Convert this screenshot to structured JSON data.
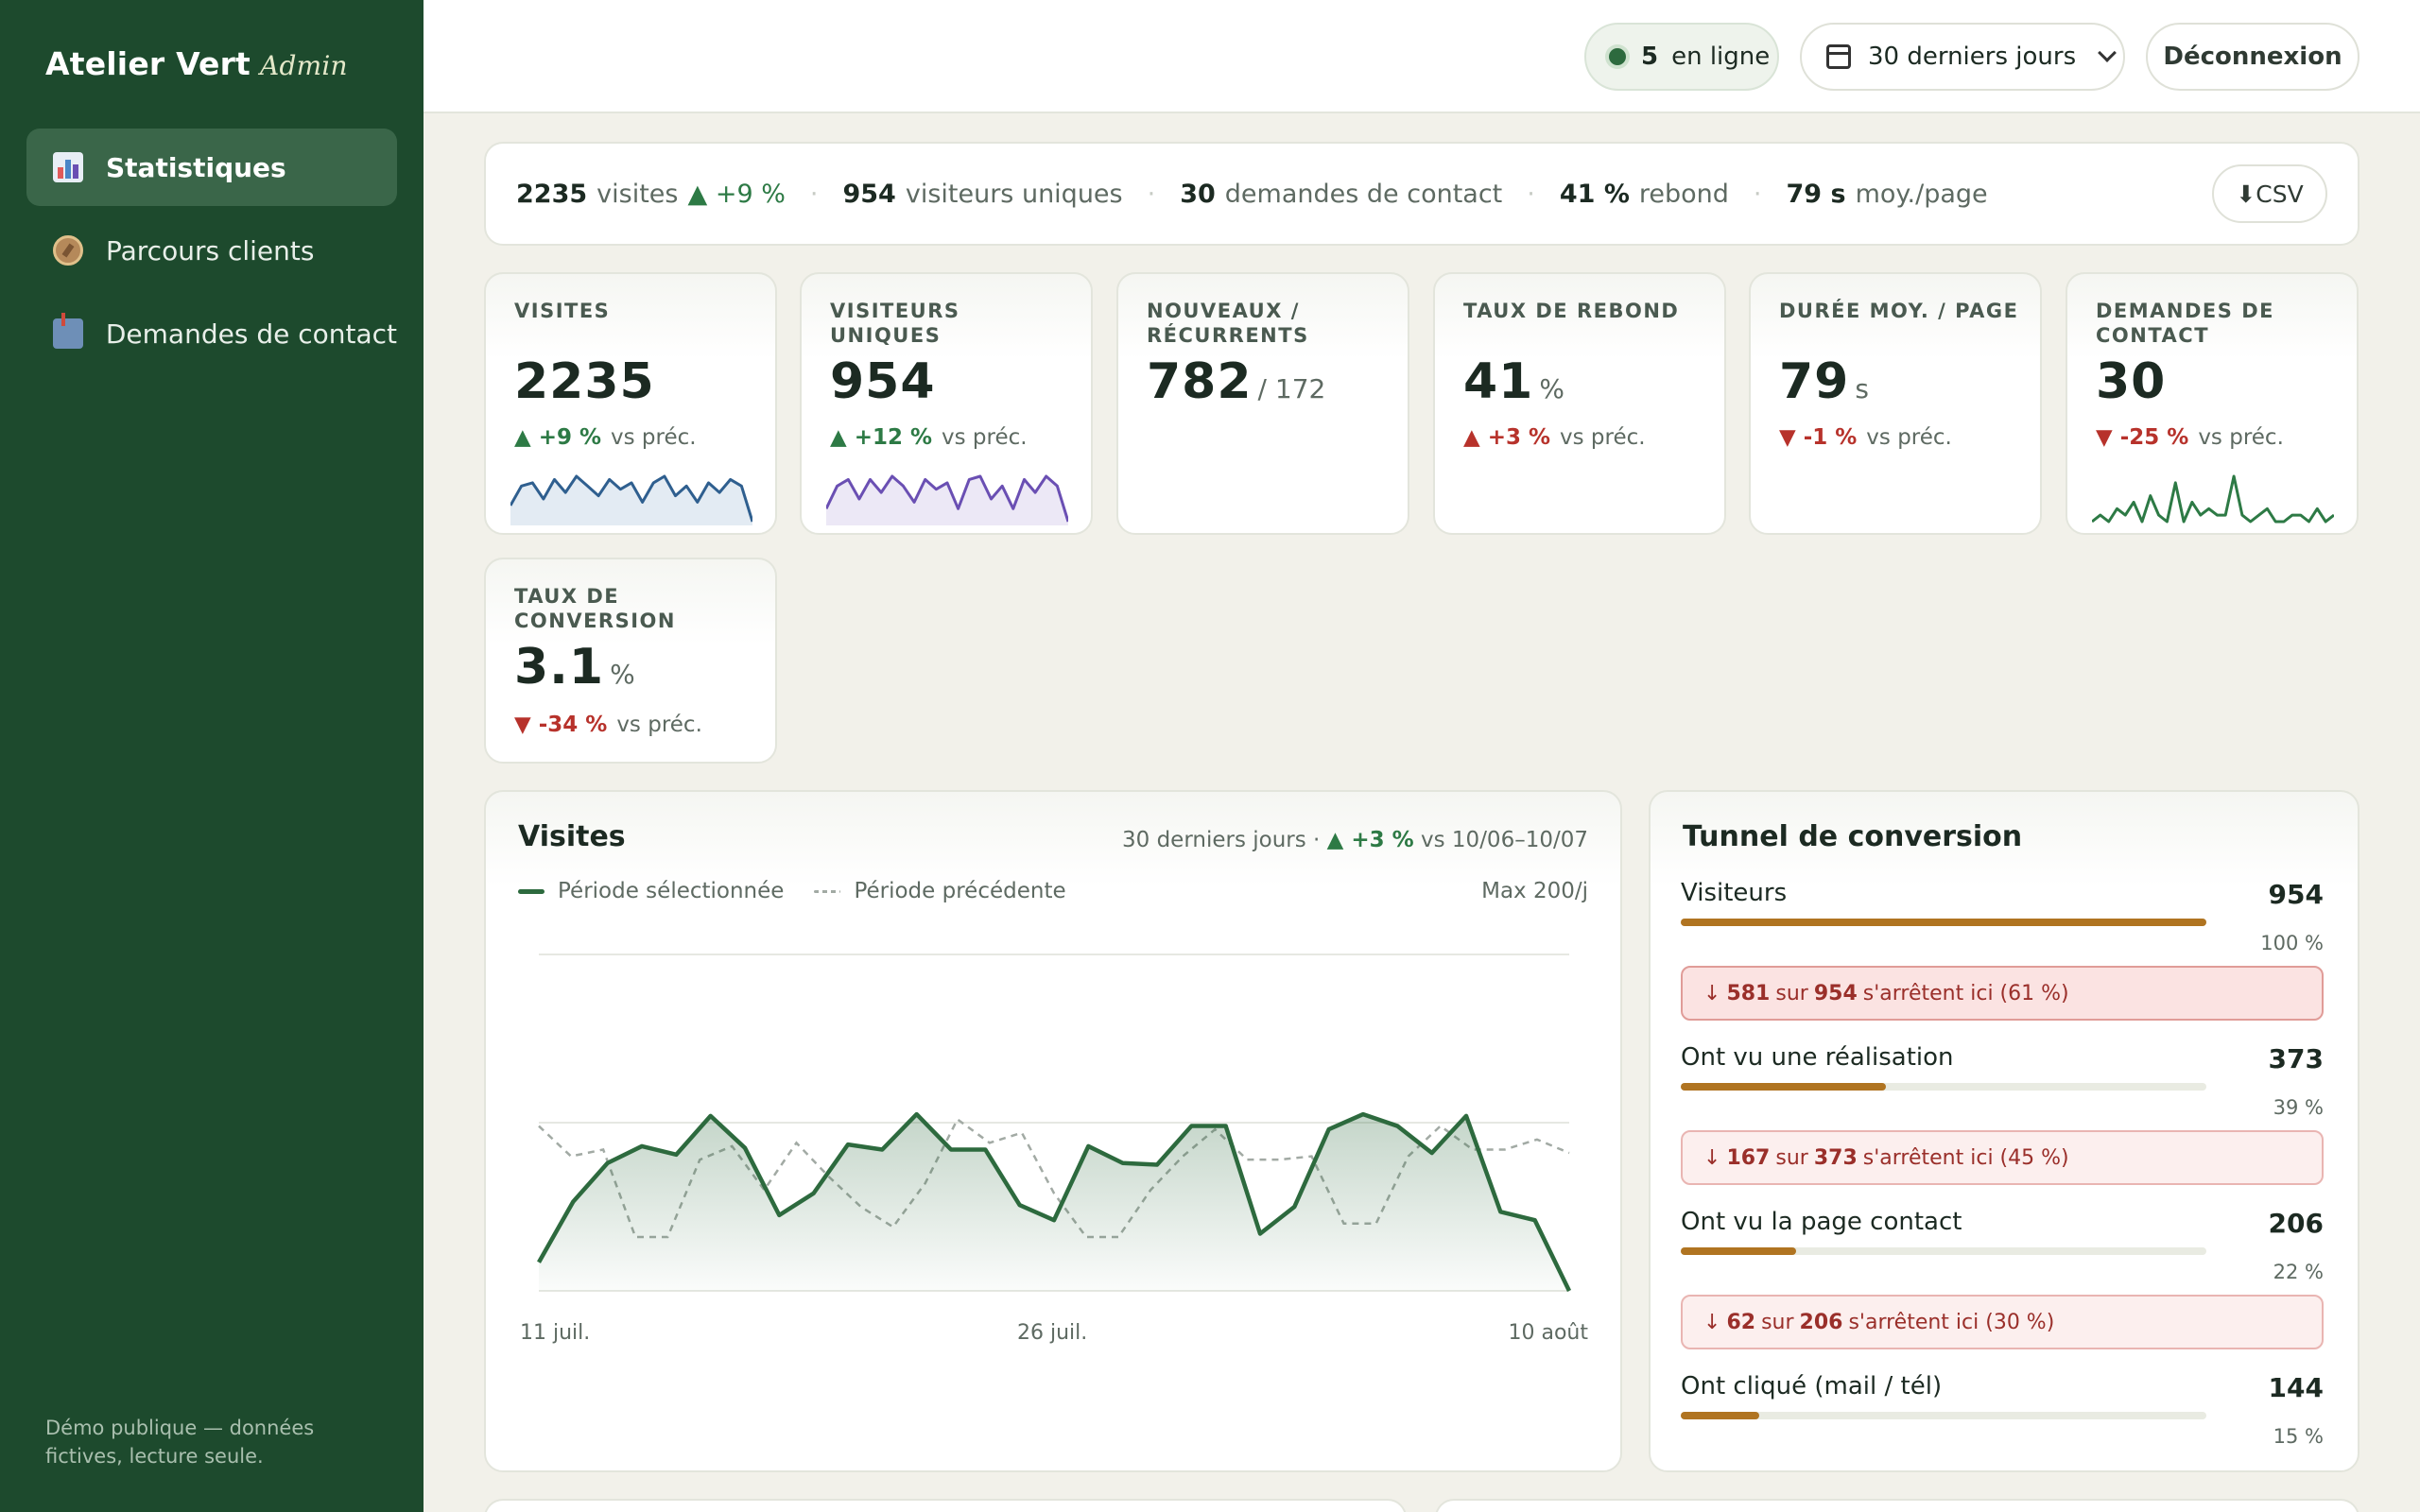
{
  "app": {
    "brand": "Atelier Vert",
    "brand_sub": "Admin"
  },
  "sidebar": {
    "items": [
      {
        "label": "Statistiques",
        "icon": "bar-chart-icon",
        "active": true
      },
      {
        "label": "Parcours clients",
        "icon": "compass-icon",
        "active": false
      },
      {
        "label": "Demandes de contact",
        "icon": "mailbox-icon",
        "active": false
      }
    ],
    "footer": "Démo publique — données fictives, lecture seule."
  },
  "topbar": {
    "online_count": "5",
    "online_label": "en ligne",
    "period": "30 derniers jours",
    "logout": "Déconnexion"
  },
  "summary": {
    "visits": "2235",
    "visits_label": "visites",
    "visits_delta": "▲ +9 %",
    "uniques": "954",
    "uniques_label": "visiteurs uniques",
    "contacts": "30",
    "contacts_label": "demandes de contact",
    "bounce": "41 %",
    "bounce_label": "rebond",
    "avg": "79 s",
    "avg_label": "moy./page",
    "csv": "⬇CSV"
  },
  "kpis": [
    {
      "label": "Visites",
      "value": "2235",
      "unit": "",
      "delta": "▲ +9 %",
      "delta_dir": "pos",
      "vs": "vs préc."
    },
    {
      "label": "Visiteurs uniques",
      "value": "954",
      "unit": "",
      "delta": "▲ +12 %",
      "delta_dir": "pos",
      "vs": "vs préc."
    },
    {
      "label": "Nouveaux / récurrents",
      "value": "782",
      "unit": "/ 172",
      "delta": "",
      "delta_dir": "",
      "vs": ""
    },
    {
      "label": "Taux de rebond",
      "value": "41",
      "unit": "%",
      "delta": "▲ +3 %",
      "delta_dir": "neg",
      "vs": "vs préc."
    },
    {
      "label": "Durée moy. / page",
      "value": "79",
      "unit": "s",
      "delta": "▼ -1 %",
      "delta_dir": "neg",
      "vs": "vs préc."
    },
    {
      "label": "Demandes de contact",
      "value": "30",
      "unit": "",
      "delta": "▼ -25 %",
      "delta_dir": "neg",
      "vs": "vs préc."
    },
    {
      "label": "Taux de conversion",
      "value": "3.1",
      "unit": "%",
      "delta": "▼ -34 %",
      "delta_dir": "neg",
      "vs": "vs préc."
    }
  ],
  "sparklines": {
    "visits": {
      "color": "#2f5f8f",
      "fill": "#e3ebf3",
      "values": [
        58,
        70,
        72,
        62,
        74,
        66,
        76,
        70,
        64,
        74,
        68,
        72,
        60,
        72,
        76,
        64,
        70,
        60,
        72,
        66,
        74,
        70,
        48
      ]
    },
    "uniques": {
      "color": "#6a4fb3",
      "fill": "#ece8f6",
      "values": [
        52,
        66,
        70,
        58,
        70,
        62,
        72,
        66,
        56,
        70,
        64,
        68,
        52,
        70,
        72,
        58,
        66,
        52,
        70,
        62,
        72,
        66,
        44
      ]
    },
    "contacts": {
      "color": "#2d7a45",
      "fill": "none",
      "values": [
        2,
        3,
        2,
        4,
        3,
        5,
        2,
        6,
        3,
        2,
        8,
        2,
        5,
        3,
        4,
        3,
        3,
        9,
        3,
        2,
        3,
        4,
        2,
        2,
        3,
        3,
        2,
        4,
        2,
        3
      ]
    }
  },
  "visits_chart": {
    "title": "Visites",
    "meta_period": "30 derniers jours ·",
    "meta_delta": "▲ +3 %",
    "meta_compare": "vs 10/06–10/07",
    "max_label": "Max 200/j",
    "legend_current": "Période sélectionnée",
    "legend_previous": "Période précédente",
    "x_ticks": [
      "11 juil.",
      "26 juil.",
      "10 août"
    ]
  },
  "chart_data": {
    "type": "line",
    "title": "Visites",
    "ylim": [
      0,
      200
    ],
    "x_ticks": [
      "11 juil.",
      "26 juil.",
      "10 août"
    ],
    "series": [
      {
        "name": "Période sélectionnée",
        "color": "#2d6a3e",
        "values": [
          17,
          53,
          76,
          86,
          81,
          104,
          85,
          45,
          58,
          87,
          84,
          105,
          84,
          84,
          51,
          42,
          86,
          76,
          75,
          98,
          98,
          34,
          50,
          96,
          105,
          98,
          82,
          104,
          47,
          42,
          0
        ]
      },
      {
        "name": "Période précédente",
        "color": "#a2aaa4",
        "dashed": true,
        "values": [
          98,
          80,
          84,
          32,
          32,
          78,
          86,
          60,
          88,
          68,
          50,
          38,
          64,
          102,
          88,
          94,
          58,
          32,
          32,
          60,
          80,
          96,
          78,
          78,
          80,
          40,
          40,
          80,
          98,
          84,
          84,
          90,
          82
        ]
      }
    ]
  },
  "funnel": {
    "title": "Tunnel de conversion",
    "steps": [
      {
        "name": "Visiteurs",
        "value": "954",
        "pct": "100 %",
        "ratio": 1.0
      },
      {
        "name": "Ont vu une réalisation",
        "value": "373",
        "pct": "39 %",
        "ratio": 0.39
      },
      {
        "name": "Ont vu la page contact",
        "value": "206",
        "pct": "22 %",
        "ratio": 0.22
      },
      {
        "name": "Ont cliqué (mail / tél)",
        "value": "144",
        "pct": "15 %",
        "ratio": 0.15
      }
    ],
    "drops": [
      {
        "lost": "581",
        "of": "954",
        "text_sur": "sur",
        "text_end": "s'arrêtent ici (61 %)"
      },
      {
        "lost": "167",
        "of": "373",
        "text_sur": "sur",
        "text_end": "s'arrêtent ici (45 %)"
      },
      {
        "lost": "62",
        "of": "206",
        "text_sur": "sur",
        "text_end": "s'arrêtent ici (30 %)"
      }
    ]
  }
}
